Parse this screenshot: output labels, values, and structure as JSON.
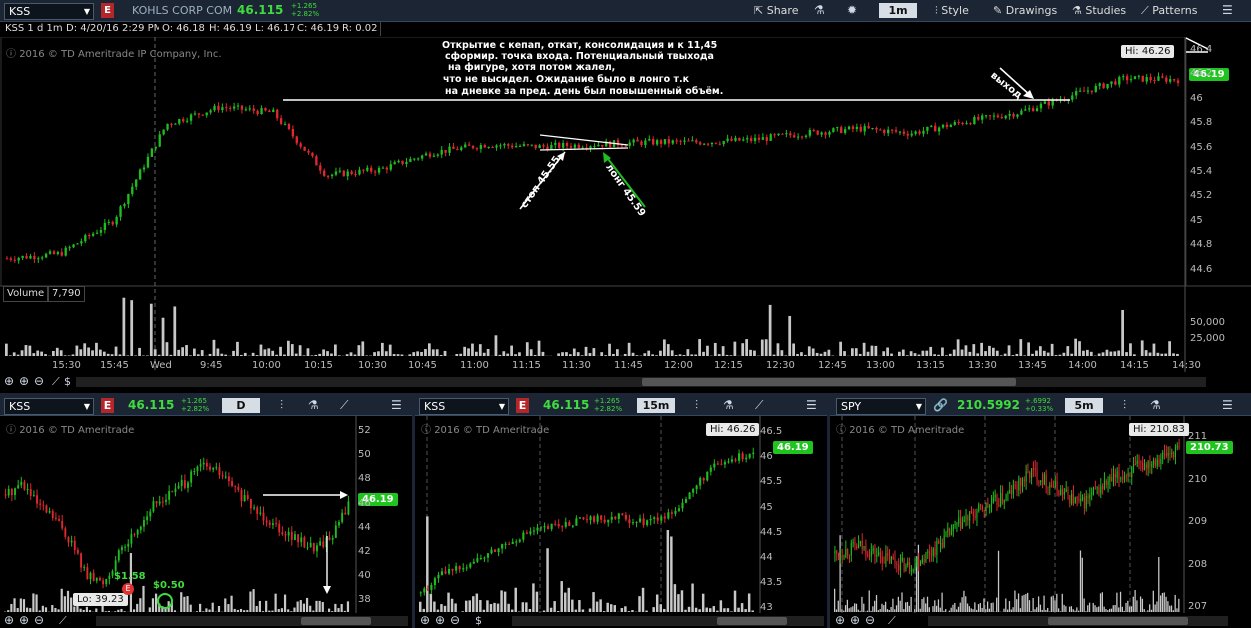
{
  "toolbar": {
    "symbol": "KSS",
    "badge": "E",
    "company": "KOHLS CORP COM",
    "price": "46.115",
    "change_abs": "+1.265",
    "change_pct": "+2.82%",
    "share_label": "Share",
    "timeframe": "1m",
    "style_label": "Style",
    "drawings_label": "Drawings",
    "studies_label": "Studies",
    "patterns_label": "Patterns",
    "icons": [
      "share-icon",
      "flask-icon",
      "gear-icon",
      "style-icon",
      "pencil-icon",
      "studies-icon",
      "patterns-icon",
      "menu-icon"
    ]
  },
  "info_bar": {
    "title": "KSS 1 d 1m",
    "date": "D: 4/20/16 2:29 PM",
    "open": "O: 46.18",
    "high": "H: 46.19",
    "low": "L: 46.17",
    "close": "C: 46.19",
    "range": "R: 0.02"
  },
  "main_chart": {
    "copyright": "2016 © TD Ameritrade IP Company, Inc.",
    "annotation_lines": [
      "Открытие с кепап, откат, консолидация и к 11,45",
      "сформир. точка входа. Потенциальный твыхода",
      "на фигуре, хотя потом жалел,",
      "что не высидел. Ожидание было в лонго т.к",
      "на дневке за пред. день был  повышенный объём."
    ],
    "label_exit": "выход",
    "label_stop": "стоп 45.55",
    "label_long": "лонг 45.59",
    "hi_label": "Hi: 46.26",
    "last_price": "46.19",
    "y_ticks": [
      "46.4",
      "46.2",
      "46",
      "45.8",
      "45.6",
      "45.4",
      "45.2",
      "45",
      "44.8",
      "44.6"
    ],
    "x_ticks": [
      "15:30",
      "15:45",
      "Wed",
      "9:45",
      "10:00",
      "10:15",
      "10:30",
      "10:45",
      "11:00",
      "11:15",
      "11:30",
      "11:45",
      "12:00",
      "12:15",
      "12:30",
      "12:45",
      "13:00",
      "13:15",
      "13:30",
      "13:45",
      "14:00",
      "14:15",
      "14:30"
    ],
    "volume_label": "Volume",
    "volume_value": "7,790",
    "volume_ticks": [
      "50,000",
      "25,000"
    ]
  },
  "panels": [
    {
      "symbol": "KSS",
      "badge": "E",
      "price": "46.115",
      "change_abs": "+1.265",
      "change_pct": "+2.82%",
      "timeframe": "D",
      "copyright": "2016 © TD Ameritrade",
      "y_ticks": [
        "52",
        "50",
        "48",
        "46",
        "44",
        "42",
        "40",
        "38"
      ],
      "last_price": "46.19",
      "lo_label": "Lo: 39.23",
      "marker1": "$1.58",
      "marker2": "$0.50",
      "marker_e": "E"
    },
    {
      "symbol": "KSS",
      "badge": "E",
      "price": "46.115",
      "change_abs": "+1.265",
      "change_pct": "+2.82%",
      "timeframe": "15m",
      "copyright": "2016 © TD Ameritrade",
      "y_ticks": [
        "46.5",
        "46",
        "45.5",
        "45",
        "44.5",
        "44",
        "43.5",
        "43"
      ],
      "hi_label": "Hi: 46.26",
      "last_price": "46.19"
    },
    {
      "symbol": "SPY",
      "price": "210.5992",
      "change_abs": "+.6992",
      "change_pct": "+0.33%",
      "timeframe": "5m",
      "copyright": "2016 © TD Ameritrade",
      "y_ticks": [
        "211",
        "210",
        "209",
        "208",
        "207"
      ],
      "hi_label": "Hi: 210.83",
      "last_price": "210.73"
    }
  ],
  "colors": {
    "up": "#1fbd1f",
    "down": "#e0282e",
    "volume": "#c8c8c8",
    "bg": "#000000",
    "toolbar": "#1b2533"
  },
  "chart_data": [
    {
      "type": "candlestick",
      "title": "KSS 1 d 1m",
      "ylim": [
        44.5,
        46.45
      ],
      "x": [
        "15:30",
        "15:45",
        "Wed 9:30",
        "9:45",
        "10:00",
        "10:15",
        "10:30",
        "10:45",
        "11:00",
        "11:15",
        "11:30",
        "11:45",
        "12:00",
        "12:15",
        "12:30",
        "12:45",
        "13:00",
        "13:15",
        "13:30",
        "13:45",
        "14:00",
        "14:15",
        "14:29"
      ],
      "close": [
        44.62,
        44.66,
        44.95,
        45.8,
        45.95,
        45.9,
        45.35,
        45.4,
        45.55,
        45.62,
        45.6,
        45.62,
        45.64,
        45.64,
        45.66,
        45.72,
        45.76,
        45.72,
        45.82,
        45.9,
        46.05,
        46.2,
        46.19
      ],
      "volume_ylim": [
        0,
        60000
      ]
    },
    {
      "type": "candlestick",
      "symbol": "KSS",
      "timeframe": "D",
      "ylim": [
        37,
        53
      ],
      "close": [
        47,
        48,
        46,
        45,
        43,
        40,
        39.5,
        42,
        44,
        46,
        47,
        48,
        49.5,
        49,
        47.5,
        46,
        45,
        44,
        43,
        42.5,
        43.5,
        46.19
      ]
    },
    {
      "type": "candlestick",
      "symbol": "KSS",
      "timeframe": "15m",
      "ylim": [
        42.8,
        46.8
      ],
      "close": [
        43.2,
        43.6,
        43.8,
        44.0,
        44.3,
        44.5,
        44.6,
        44.7,
        44.75,
        44.8,
        44.7,
        44.8,
        45.2,
        45.8,
        46.0,
        46.19
      ]
    },
    {
      "type": "candlestick",
      "symbol": "SPY",
      "timeframe": "5m",
      "ylim": [
        206.8,
        211.4
      ],
      "close": [
        208.2,
        208.4,
        208.1,
        207.9,
        208.3,
        208.9,
        209.3,
        209.6,
        210.2,
        209.8,
        209.4,
        209.9,
        210.2,
        210.5,
        210.73
      ]
    }
  ]
}
